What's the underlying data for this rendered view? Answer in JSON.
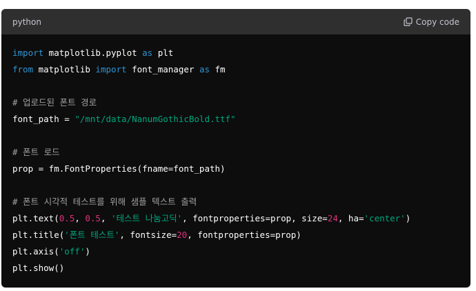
{
  "header": {
    "language": "python",
    "copy_label": "Copy code",
    "copy_icon": "copy-icon"
  },
  "colors": {
    "keyword": "#2e95d3",
    "comment": "#a0a0a0",
    "string": "#00a67d",
    "number": "#df3079",
    "plain": "#ffffff",
    "background": "#0d0d0d",
    "header_bg": "#2f2f2f"
  },
  "code_lines": [
    [
      {
        "t": "kw",
        "v": "import"
      },
      {
        "t": "pl",
        "v": " matplotlib.pyplot "
      },
      {
        "t": "kw",
        "v": "as"
      },
      {
        "t": "pl",
        "v": " plt"
      }
    ],
    [
      {
        "t": "kw",
        "v": "from"
      },
      {
        "t": "pl",
        "v": " matplotlib "
      },
      {
        "t": "kw",
        "v": "import"
      },
      {
        "t": "pl",
        "v": " font_manager "
      },
      {
        "t": "kw",
        "v": "as"
      },
      {
        "t": "pl",
        "v": " fm"
      }
    ],
    [],
    [
      {
        "t": "cm",
        "v": "# 업로드된 폰트 경로"
      }
    ],
    [
      {
        "t": "pl",
        "v": "font_path = "
      },
      {
        "t": "str",
        "v": "\"/mnt/data/NanumGothicBold.ttf\""
      }
    ],
    [],
    [
      {
        "t": "cm",
        "v": "# 폰트 로드"
      }
    ],
    [
      {
        "t": "pl",
        "v": "prop = fm.FontProperties(fname=font_path)"
      }
    ],
    [],
    [
      {
        "t": "cm",
        "v": "# 폰트 시각적 테스트를 위해 샘플 텍스트 출력"
      }
    ],
    [
      {
        "t": "pl",
        "v": "plt.text("
      },
      {
        "t": "num",
        "v": "0.5"
      },
      {
        "t": "pl",
        "v": ", "
      },
      {
        "t": "num",
        "v": "0.5"
      },
      {
        "t": "pl",
        "v": ", "
      },
      {
        "t": "str",
        "v": "'테스트 나눔고딕'"
      },
      {
        "t": "pl",
        "v": ", fontproperties=prop, size="
      },
      {
        "t": "num",
        "v": "24"
      },
      {
        "t": "pl",
        "v": ", ha="
      },
      {
        "t": "str",
        "v": "'center'"
      },
      {
        "t": "pl",
        "v": ")"
      }
    ],
    [
      {
        "t": "pl",
        "v": "plt.title("
      },
      {
        "t": "str",
        "v": "'폰트 테스트'"
      },
      {
        "t": "pl",
        "v": ", fontsize="
      },
      {
        "t": "num",
        "v": "20"
      },
      {
        "t": "pl",
        "v": ", fontproperties=prop)"
      }
    ],
    [
      {
        "t": "pl",
        "v": "plt.axis("
      },
      {
        "t": "str",
        "v": "'off'"
      },
      {
        "t": "pl",
        "v": ")"
      }
    ],
    [
      {
        "t": "pl",
        "v": "plt.show()"
      }
    ]
  ]
}
